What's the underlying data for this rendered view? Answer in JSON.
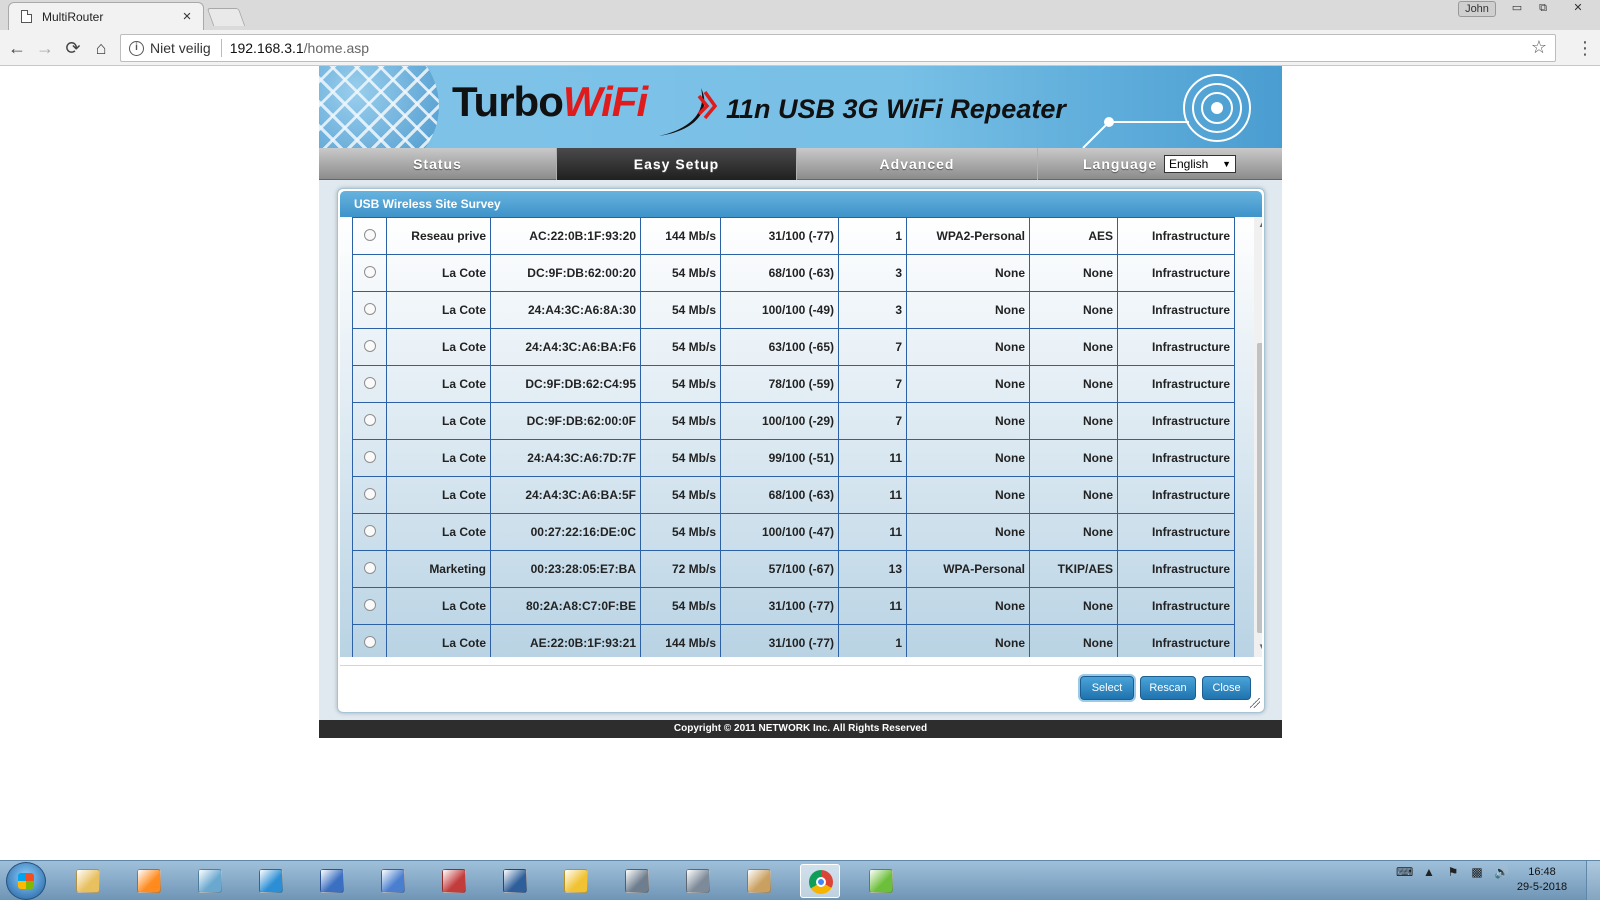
{
  "browser": {
    "tab_title": "MultiRouter",
    "tab_close": "×",
    "user_name": "John",
    "security_label": "Niet veilig",
    "url_host": "192.168.3.1",
    "url_path": "/home.asp",
    "win_min": "▭",
    "win_max": "⧉",
    "win_close": "✕"
  },
  "router": {
    "brand_a": "Turbo",
    "brand_b": "WiFi",
    "subtitle": "11n USB 3G WiFi Repeater",
    "menu": {
      "status": "Status",
      "easy_setup": "Easy Setup",
      "advanced": "Advanced",
      "language_label": "Language",
      "language_value": "English"
    },
    "dialog": {
      "title": "USB Wireless Site Survey",
      "buttons": {
        "select": "Select",
        "rescan": "Rescan",
        "close": "Close"
      },
      "rows": [
        {
          "ssid": "Reseau prive",
          "bssid": "AC:22:0B:1F:93:20",
          "rate": "144 Mb/s",
          "signal": "31/100 (-77)",
          "channel": "1",
          "security": "WPA2-Personal",
          "encryption": "AES",
          "mode": "Infrastructure"
        },
        {
          "ssid": "La Cote",
          "bssid": "DC:9F:DB:62:00:20",
          "rate": "54 Mb/s",
          "signal": "68/100 (-63)",
          "channel": "3",
          "security": "None",
          "encryption": "None",
          "mode": "Infrastructure"
        },
        {
          "ssid": "La Cote",
          "bssid": "24:A4:3C:A6:8A:30",
          "rate": "54 Mb/s",
          "signal": "100/100 (-49)",
          "channel": "3",
          "security": "None",
          "encryption": "None",
          "mode": "Infrastructure"
        },
        {
          "ssid": "La Cote",
          "bssid": "24:A4:3C:A6:BA:F6",
          "rate": "54 Mb/s",
          "signal": "63/100 (-65)",
          "channel": "7",
          "security": "None",
          "encryption": "None",
          "mode": "Infrastructure"
        },
        {
          "ssid": "La Cote",
          "bssid": "DC:9F:DB:62:C4:95",
          "rate": "54 Mb/s",
          "signal": "78/100 (-59)",
          "channel": "7",
          "security": "None",
          "encryption": "None",
          "mode": "Infrastructure"
        },
        {
          "ssid": "La Cote",
          "bssid": "DC:9F:DB:62:00:0F",
          "rate": "54 Mb/s",
          "signal": "100/100 (-29)",
          "channel": "7",
          "security": "None",
          "encryption": "None",
          "mode": "Infrastructure"
        },
        {
          "ssid": "La Cote",
          "bssid": "24:A4:3C:A6:7D:7F",
          "rate": "54 Mb/s",
          "signal": "99/100 (-51)",
          "channel": "11",
          "security": "None",
          "encryption": "None",
          "mode": "Infrastructure"
        },
        {
          "ssid": "La Cote",
          "bssid": "24:A4:3C:A6:BA:5F",
          "rate": "54 Mb/s",
          "signal": "68/100 (-63)",
          "channel": "11",
          "security": "None",
          "encryption": "None",
          "mode": "Infrastructure"
        },
        {
          "ssid": "La Cote",
          "bssid": "00:27:22:16:DE:0C",
          "rate": "54 Mb/s",
          "signal": "100/100 (-47)",
          "channel": "11",
          "security": "None",
          "encryption": "None",
          "mode": "Infrastructure"
        },
        {
          "ssid": "Marketing",
          "bssid": "00:23:28:05:E7:BA",
          "rate": "72 Mb/s",
          "signal": "57/100 (-67)",
          "channel": "13",
          "security": "WPA-Personal",
          "encryption": "TKIP/AES",
          "mode": "Infrastructure"
        },
        {
          "ssid": "La Cote",
          "bssid": "80:2A:A8:C7:0F:BE",
          "rate": "54 Mb/s",
          "signal": "31/100 (-77)",
          "channel": "11",
          "security": "None",
          "encryption": "None",
          "mode": "Infrastructure"
        },
        {
          "ssid": "La Cote",
          "bssid": "AE:22:0B:1F:93:21",
          "rate": "144 Mb/s",
          "signal": "31/100 (-77)",
          "channel": "1",
          "security": "None",
          "encryption": "None",
          "mode": "Infrastructure"
        }
      ]
    },
    "footer": "Copyright © 2011 NETWORK Inc. All Rights Reserved"
  },
  "taskbar": {
    "time": "16:48",
    "date": "29-5-2018",
    "apps": [
      "file-explorer-icon",
      "media-player-icon",
      "notebook-icon",
      "feather-pen-icon",
      "network-tool-icon",
      "word-document-icon",
      "scissors-tool-icon",
      "thunderbird-icon",
      "sticky-notes-icon",
      "calculator-icon",
      "document-stack-icon",
      "paint-icon",
      "chrome-icon",
      "spreadsheet-icon"
    ]
  }
}
